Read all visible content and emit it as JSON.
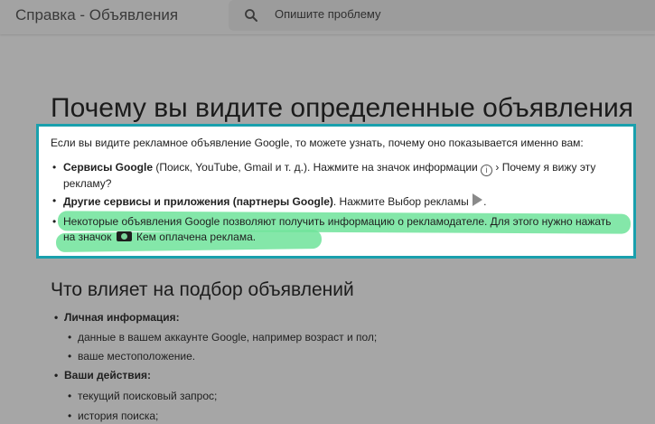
{
  "header": {
    "brand": "Справка - Объявления",
    "search_placeholder": "Опишите проблему"
  },
  "main": {
    "title": "Почему вы видите определенные объявления",
    "intro": "Если вы видите рекламное объявление Google, то можете узнать, почему оно показывается именно вам:",
    "bullets": [
      {
        "bold": "Сервисы Google",
        "text": " (Поиск, YouTube, Gmail и т. д.). Нажмите на значок информации ",
        "after_icon": " › Почему я вижу эту рекламу?"
      },
      {
        "bold": "Другие сервисы и приложения (партнеры Google)",
        "text": ". Нажмите Выбор рекламы ",
        "after_icon": "."
      },
      {
        "bold": "Некоторые объявления Google",
        "text": " позволяют получить информацию о рекламодателе. Для этого нужно нажать на значок ",
        "after_icon": " Кем оплачена реклама."
      }
    ],
    "section_title": "Что влияет на подбор объявлений",
    "factors": [
      "Личная информация:",
      "данные в вашем аккаунте Google, например возраст и пол;",
      "ваше местоположение.",
      "Ваши действия:",
      "текущий поисковый запрос;",
      "история поиска;"
    ]
  },
  "colors": {
    "highlight_border": "#1aa0ad",
    "marker": "#6ee39a"
  },
  "icons": {
    "search": "search-icon",
    "info": "info-icon",
    "adchoices": "adchoices-icon",
    "advertiser": "advertiser-icon"
  }
}
